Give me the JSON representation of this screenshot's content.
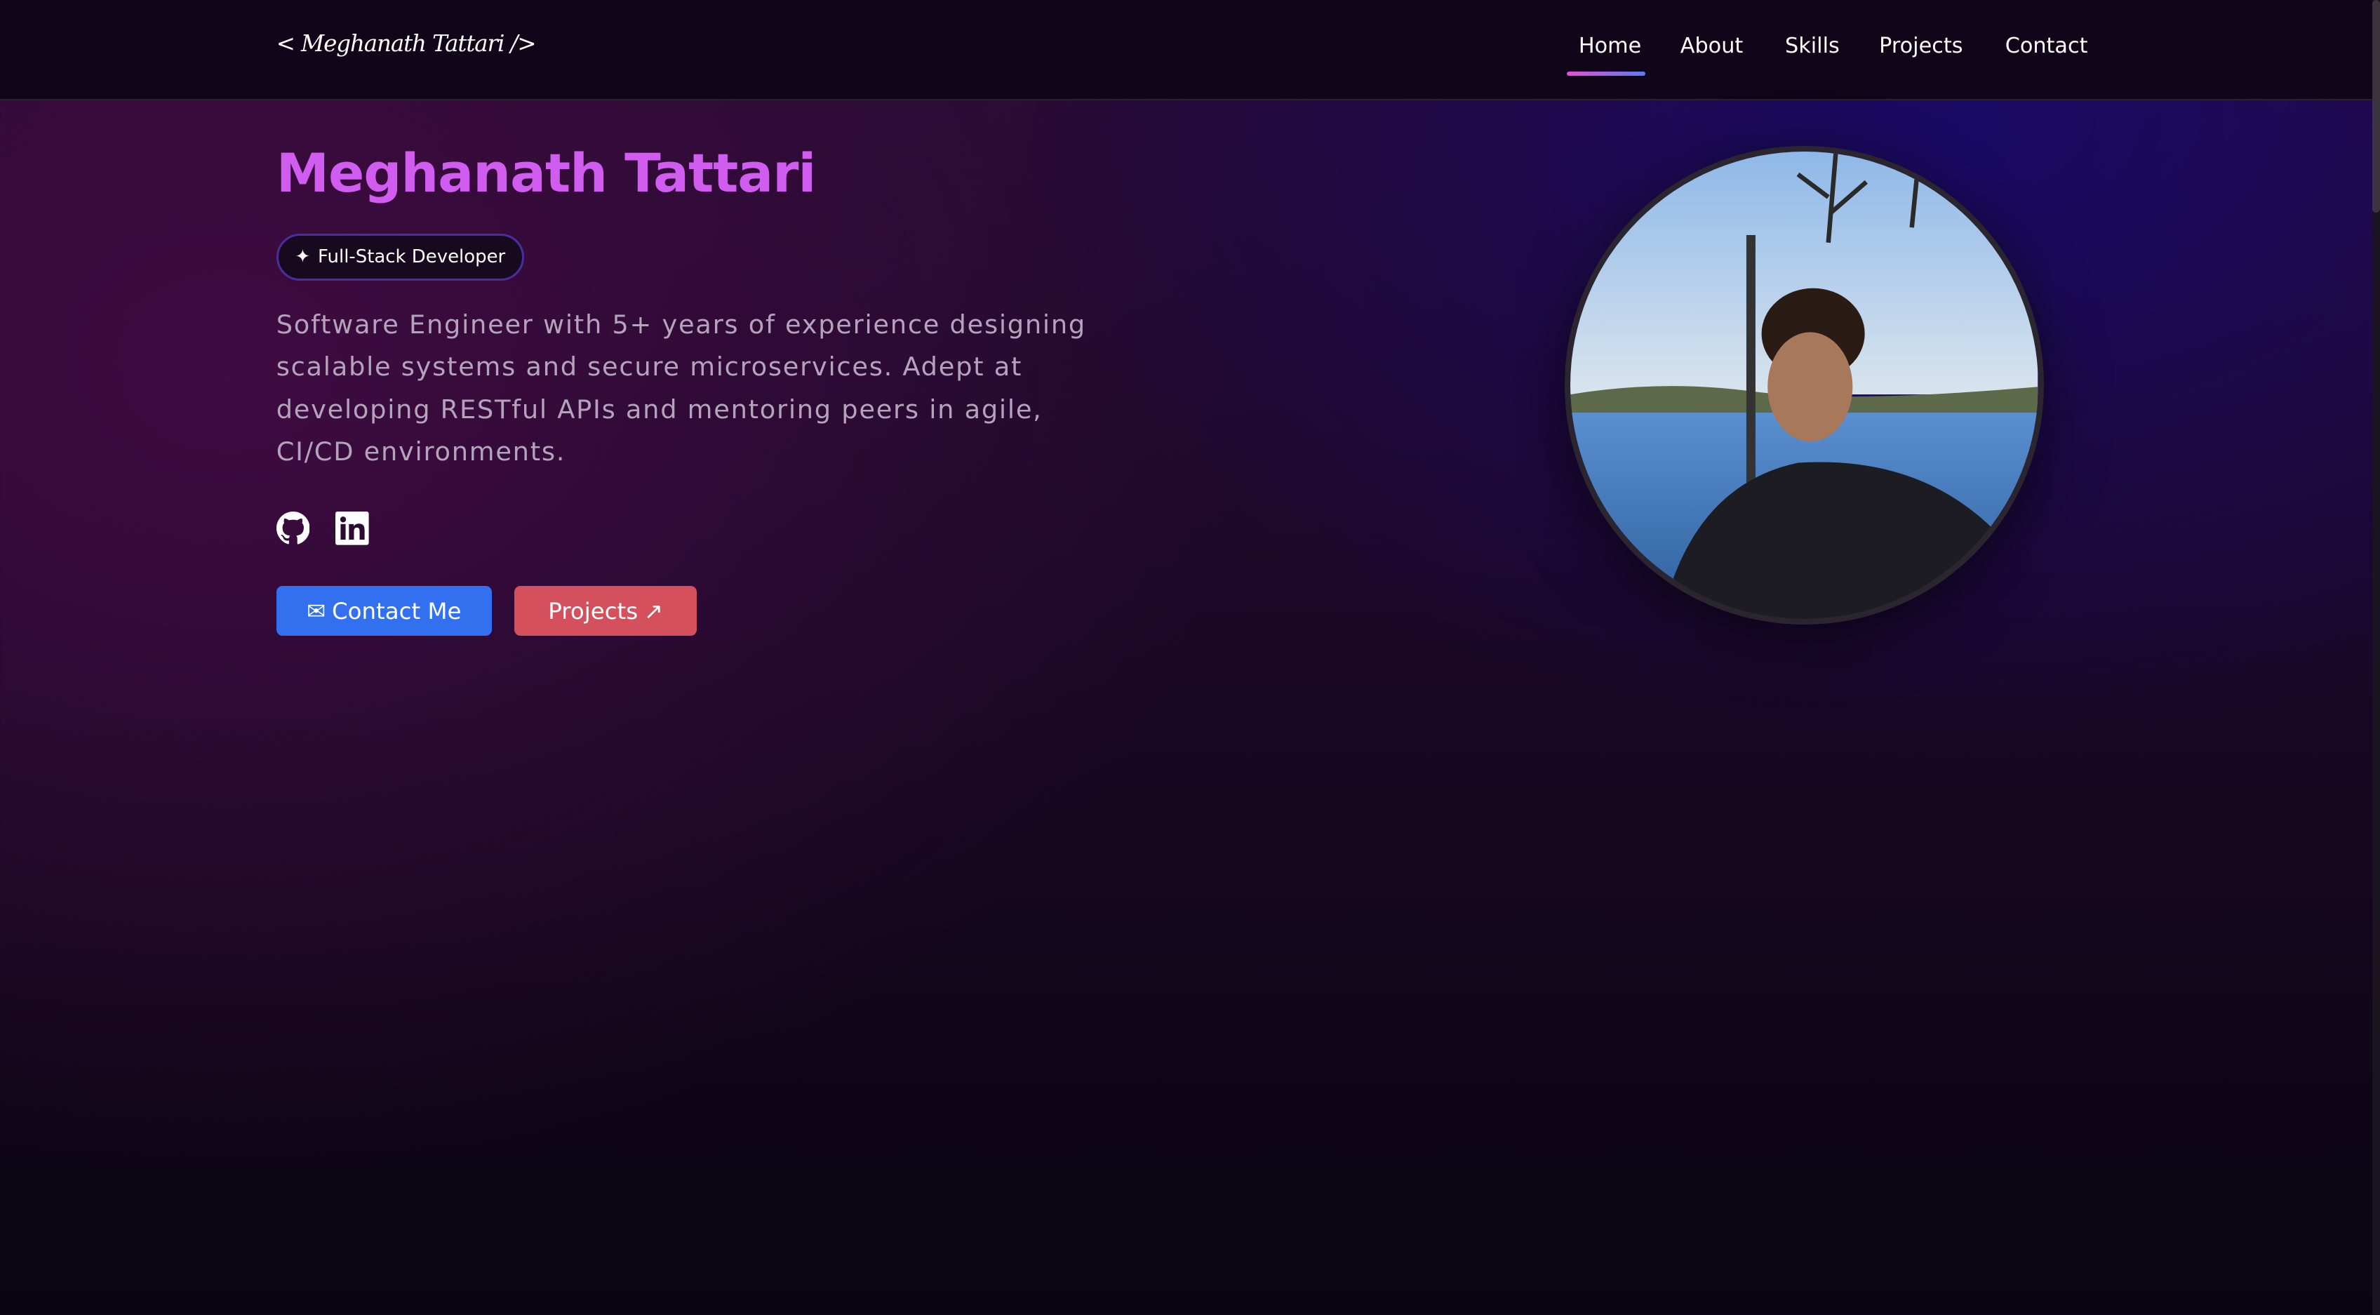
{
  "nav": {
    "logo": "< Meghanath Tattari />",
    "links": [
      "Home",
      "About",
      "Skills",
      "Projects",
      "Contact"
    ],
    "active": "Home"
  },
  "hero": {
    "name": "Meghanath Tattari",
    "badge": "Full-Stack Developer",
    "description": "Software Engineer with 5+ years of experience designing scalable systems and secure microservices. Adept at developing RESTful APIs and mentoring peers in agile, CI/CD environments.",
    "social": [
      "github-icon",
      "linkedin-icon"
    ],
    "contact_button": "Contact Me",
    "projects_button": "Projects"
  },
  "colors": {
    "accent": "#d05cf0",
    "contact": "#3370f0",
    "projects": "#d4505c"
  }
}
